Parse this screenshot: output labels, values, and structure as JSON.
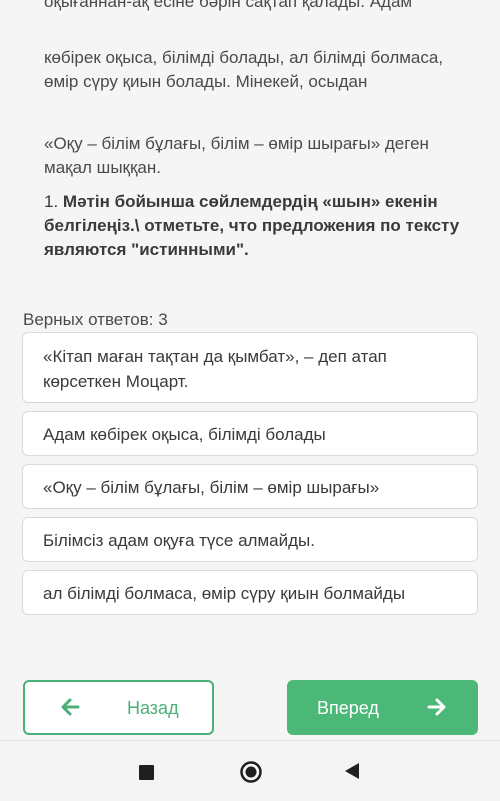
{
  "passage": {
    "cut_line": "оқығаннан-ақ есіне бәрін сақтап қалады. Адам",
    "line2": "көбірек оқыса, білімді болады, ал білімді болмаса, өмір сүру қиын болады. Мінекей, осыдан",
    "line3": "«Оқу – білім бұлағы, білім – өмір шырағы» деген мақал шыққан."
  },
  "question": {
    "number": "1.",
    "text": "Мәтін бойынша сөйлемдердің «шын» екенін белгілеңіз.\\ отметьте, что предложения по тексту являются \"истинными\"."
  },
  "correct_answers_label": "Верных ответов: 3",
  "options": [
    "«Кітап маған тақтан да қымбат», – деп атап көрсеткен Моцарт.",
    "Адам көбірек оқыса, білімді болады",
    "«Оқу – білім бұлағы, білім – өмір шырағы»",
    "Білімсіз адам оқуға түсе алмайды.",
    "ал білімді болмаса, өмір сүру қиын болмайды"
  ],
  "navigation": {
    "back_label": "Назад",
    "next_label": "Вперед"
  },
  "colors": {
    "accent_green": "#4cb878",
    "border_gray": "#d9dadb"
  },
  "icons": {
    "back": "arrow-left-icon",
    "next": "arrow-right-icon",
    "system_recents": "square-icon",
    "system_home": "circle-icon",
    "system_back": "triangle-icon"
  }
}
